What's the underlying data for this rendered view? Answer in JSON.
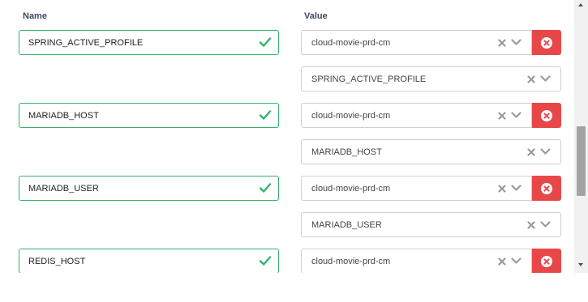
{
  "headers": {
    "name": "Name",
    "value": "Value"
  },
  "colors": {
    "valid": "#34b36b",
    "danger": "#e8474a"
  },
  "rows": [
    {
      "name": "SPRING_ACTIVE_PROFILE",
      "value": "cloud-movie-prd-cm",
      "source": "SPRING_ACTIVE_PROFILE"
    },
    {
      "name": "MARIADB_HOST",
      "value": "cloud-movie-prd-cm",
      "source": "MARIADB_HOST"
    },
    {
      "name": "MARIADB_USER",
      "value": "cloud-movie-prd-cm",
      "source": "MARIADB_USER"
    },
    {
      "name": "REDIS_HOST",
      "value": "cloud-movie-prd-cm"
    }
  ],
  "icons": {
    "valid": "check-icon",
    "clear": "clear-x-icon",
    "dropdown": "chevron-down-icon",
    "remove": "remove-circle-x-icon"
  }
}
